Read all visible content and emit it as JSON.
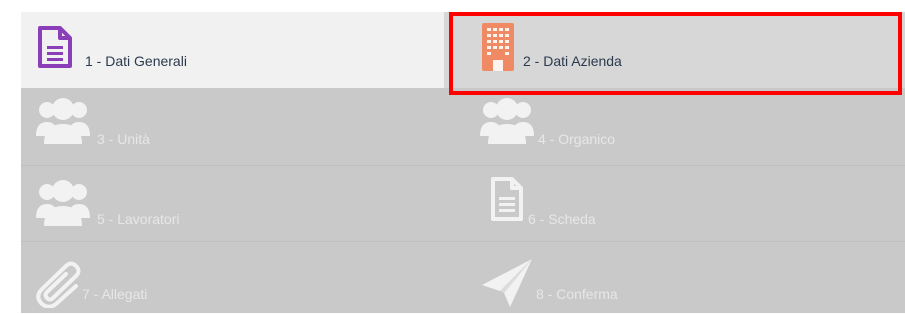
{
  "wizard": {
    "steps": [
      {
        "label": "1 - Dati Generali",
        "icon": "document-icon",
        "state": "completed"
      },
      {
        "label": "2 - Dati Azienda",
        "icon": "building-icon",
        "state": "active"
      },
      {
        "label": "3 - Unità",
        "icon": "users-icon",
        "state": "disabled"
      },
      {
        "label": "4 - Organico",
        "icon": "users-icon",
        "state": "disabled"
      },
      {
        "label": "5 - Lavoratori",
        "icon": "users-icon",
        "state": "disabled"
      },
      {
        "label": "6 - Scheda",
        "icon": "document-icon",
        "state": "disabled"
      },
      {
        "label": "7 - Allegati",
        "icon": "paperclip-icon",
        "state": "disabled"
      },
      {
        "label": "8 - Conferma",
        "icon": "paper-plane-icon",
        "state": "disabled"
      }
    ]
  },
  "colors": {
    "step1_icon": "#8a3fb8",
    "step2_icon": "#f08a65",
    "disabled_icon": "#f2f2f2",
    "highlight": "#ff0000"
  }
}
